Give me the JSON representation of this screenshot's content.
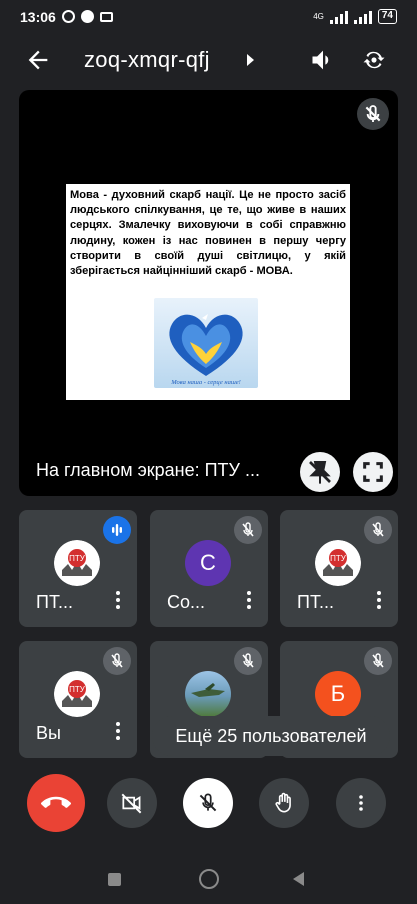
{
  "status": {
    "time": "13:06",
    "network": "4G",
    "battery": "74"
  },
  "meeting": {
    "code": "zoq-xmqr-qfj"
  },
  "presentation": {
    "slide_text": "Мова - духовний скарб нації. Це не просто засіб людського спілкування, це те, що живе в наших серцях. Змалечку виховуючи в собі справжню людину, кожен із нас повинен в першу чергу створити в своїй душі світлицю, у якій зберігається найцінніший скарб - МОВА.",
    "image_caption": "Мова наша - серце наше!",
    "caption": "На главном экране: ПТУ ..."
  },
  "participants": [
    {
      "name": "ПТ...",
      "avatar": "logo",
      "status": "speaking"
    },
    {
      "name": "Со...",
      "avatar": "letter",
      "letter": "С",
      "color": "#5e35b1",
      "status": "muted"
    },
    {
      "name": "ПТ...",
      "avatar": "logo",
      "status": "muted"
    },
    {
      "name": "Вы",
      "avatar": "logo",
      "status": "muted"
    },
    {
      "name": "",
      "avatar": "photo",
      "status": "muted"
    },
    {
      "name": "",
      "avatar": "letter",
      "letter": "Б",
      "color": "#f4511e",
      "status": "muted"
    }
  ],
  "more_participants": "Ещё 25 пользователей",
  "controls": [
    "end-call",
    "camera-off",
    "mic-off",
    "raise-hand",
    "more"
  ],
  "colors": {
    "end_call": "#ea4335",
    "tile": "#3c4043",
    "background": "#202124",
    "speaking": "#1a73e8"
  }
}
